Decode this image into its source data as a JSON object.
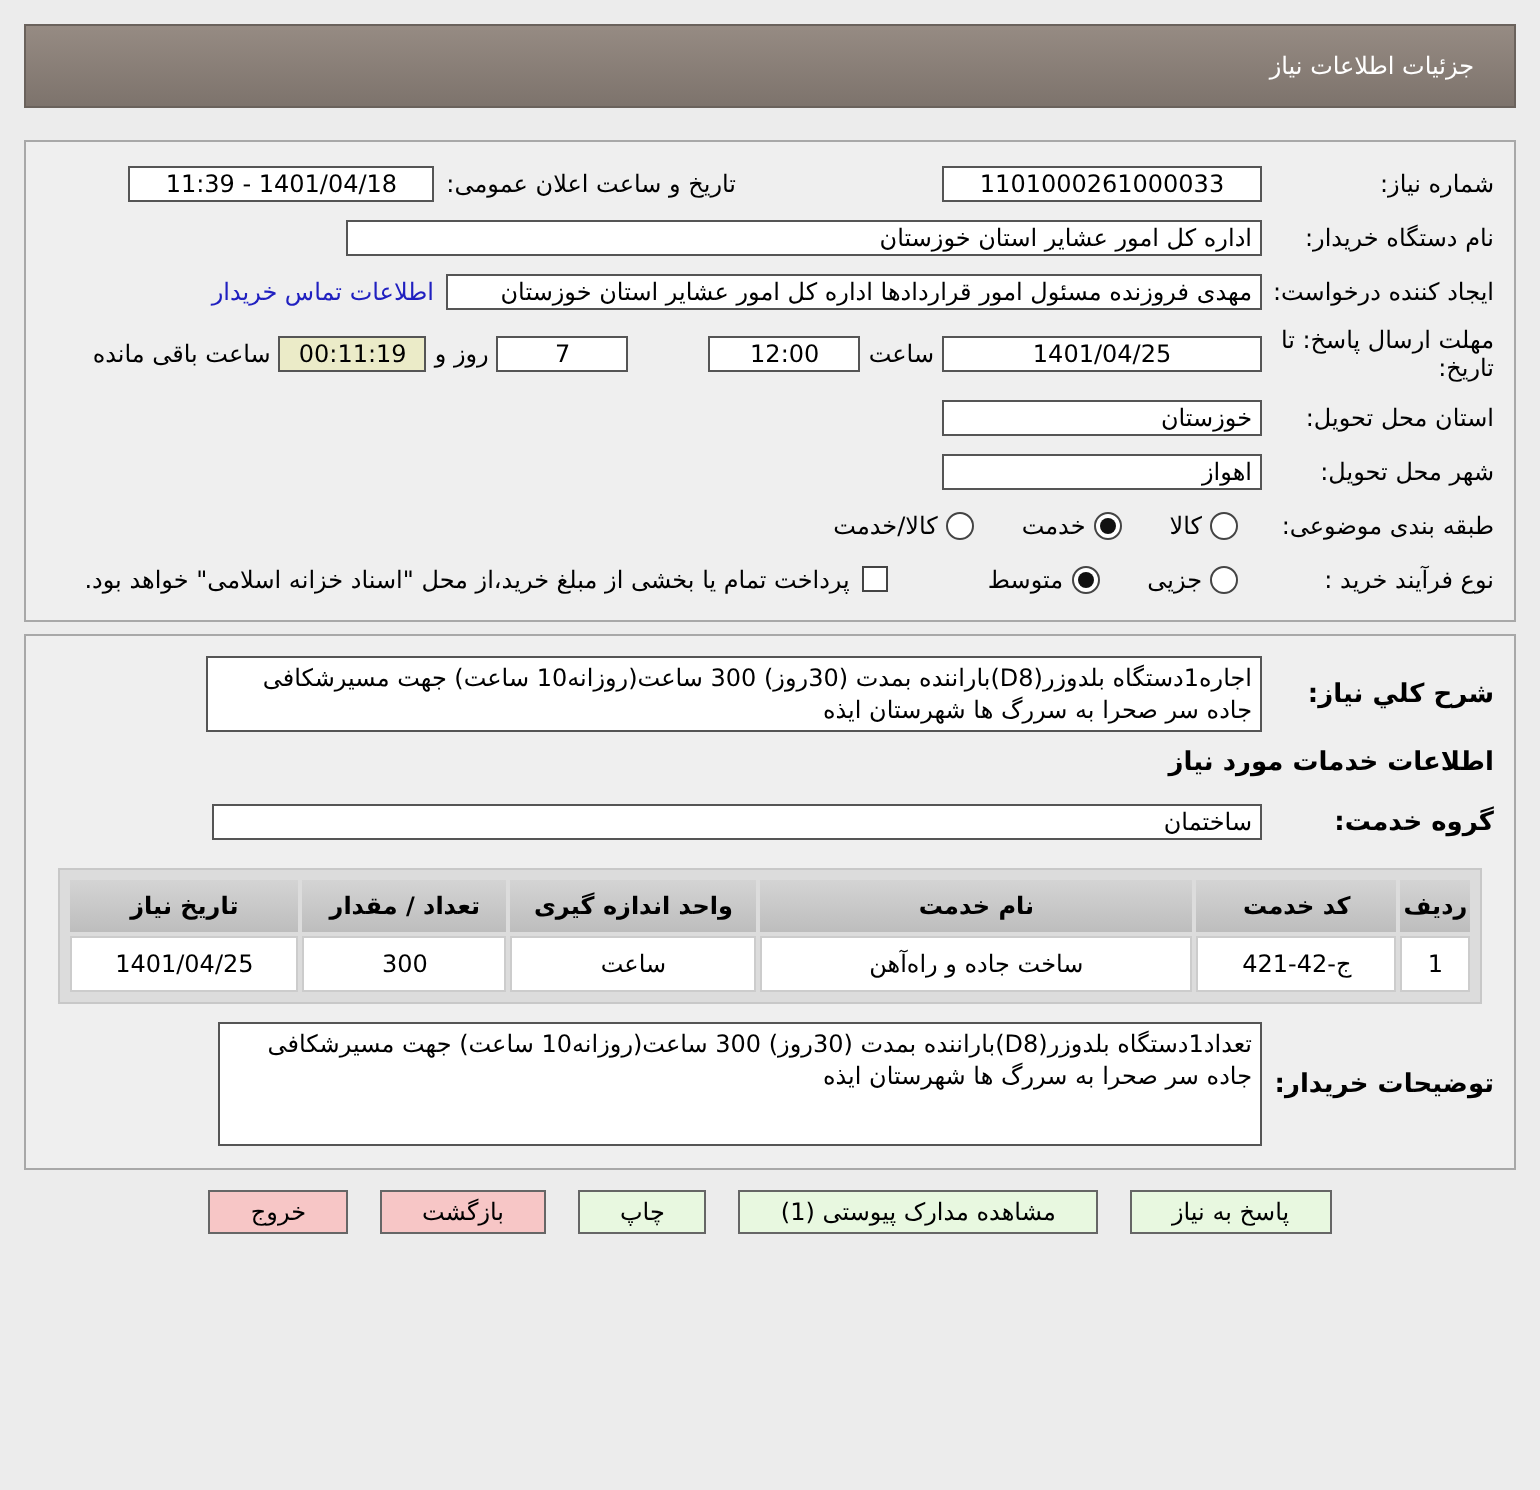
{
  "header": {
    "title": "جزئیات اطلاعات نیاز"
  },
  "need_number": {
    "label": "شماره نیاز:",
    "value": "1101000261000033"
  },
  "announce": {
    "label": "تاریخ و ساعت اعلان عمومی:",
    "value": "1401/04/18 - 11:39"
  },
  "buyer_org": {
    "label": "نام دستگاه خریدار:",
    "value": "اداره کل امور عشایر استان خوزستان"
  },
  "requester": {
    "label": "ایجاد کننده درخواست:",
    "value": "مهدی فروزنده مسئول امور قراردادها اداره کل امور عشایر استان خوزستان",
    "link": "اطلاعات تماس خریدار"
  },
  "deadline": {
    "label": "مهلت ارسال پاسخ: تا تاریخ:",
    "date": "1401/04/25",
    "time_label": "ساعت",
    "time": "12:00",
    "days": "7",
    "days_label": "روز و",
    "remaining": "00:11:19",
    "remaining_label": "ساعت باقی مانده"
  },
  "province": {
    "label": "استان محل تحویل:",
    "value": "خوزستان"
  },
  "city": {
    "label": "شهر محل تحویل:",
    "value": "اهواز"
  },
  "category": {
    "label": "طبقه بندی موضوعی:",
    "options": [
      {
        "label": "کالا",
        "selected": false
      },
      {
        "label": "خدمت",
        "selected": true
      },
      {
        "label": "کالا/خدمت",
        "selected": false
      }
    ]
  },
  "process": {
    "label": "نوع فرآیند خرید :",
    "options": [
      {
        "label": "جزیی",
        "selected": false
      },
      {
        "label": "متوسط",
        "selected": true
      }
    ],
    "payment": {
      "checked": false,
      "label": "پرداخت تمام یا بخشی از مبلغ خرید،از محل \"اسناد خزانه اسلامی\" خواهد بود."
    }
  },
  "summary": {
    "label": "شرح کلي نياز:",
    "value": "اجاره1دستگاه بلدوزر(D8)باراننده بمدت (30روز)  300 ساعت(روزانه10 ساعت) جهت مسیرشکافی جاده سر صحرا به سررگ ها شهرستان ایذه"
  },
  "services_title": "اطلاعات خدمات مورد نیاز",
  "service_group": {
    "label": "گروه خدمت:",
    "value": "ساختمان"
  },
  "table": {
    "columns": [
      "ردیف",
      "کد خدمت",
      "نام خدمت",
      "واحد اندازه گیری",
      "تعداد / مقدار",
      "تاریخ نیاز"
    ],
    "rows": [
      [
        "1",
        "ج-42-421",
        "ساخت جاده و راه‌آهن",
        "ساعت",
        "300",
        "1401/04/25"
      ]
    ]
  },
  "buyer_notes": {
    "label": "توضیحات خریدار:",
    "value": "تعداد1دستگاه بلدوزر(D8)باراننده بمدت (30روز)  300 ساعت(روزانه10 ساعت) جهت مسیرشکافی جاده سر صحرا به سررگ ها شهرستان ایذه"
  },
  "buttons": [
    {
      "label": "پاسخ به نیاز",
      "kind": "action"
    },
    {
      "label": "مشاهده مدارک پیوستی (1)",
      "kind": "action"
    },
    {
      "label": "چاپ",
      "kind": "action"
    },
    {
      "label": "بازگشت",
      "kind": "danger"
    },
    {
      "label": "خروج",
      "kind": "danger"
    }
  ]
}
